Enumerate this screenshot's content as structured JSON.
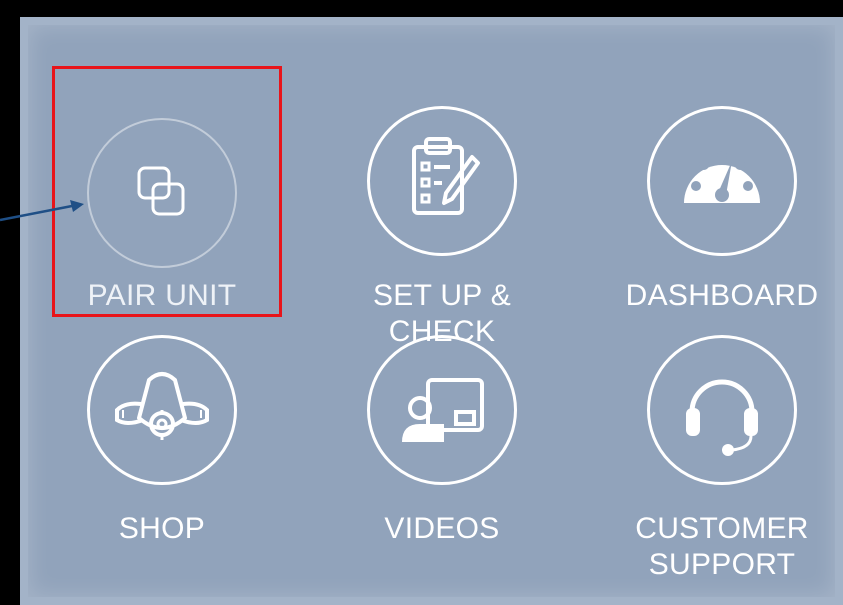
{
  "menu": {
    "items": [
      {
        "id": "pair",
        "label": "PAIR UNIT",
        "icon": "pair-squares-icon"
      },
      {
        "id": "setup",
        "label": "SET UP & CHECK",
        "icon": "clipboard-checklist-icon"
      },
      {
        "id": "dashboard",
        "label": "DASHBOARD",
        "icon": "gauge-icon"
      },
      {
        "id": "shop",
        "label": "SHOP",
        "icon": "cpap-mask-icon"
      },
      {
        "id": "videos",
        "label": "VIDEOS",
        "icon": "video-presenter-icon"
      },
      {
        "id": "support",
        "label_line1": "CUSTOMER",
        "label_line2": "SUPPORT",
        "icon": "headset-icon"
      }
    ]
  },
  "annotation": {
    "highlight_color": "#e8141a",
    "arrow_color": "#1f4f86"
  },
  "colors": {
    "background": "#91a3bb",
    "outer": "#000000",
    "icon": "#ffffff"
  }
}
